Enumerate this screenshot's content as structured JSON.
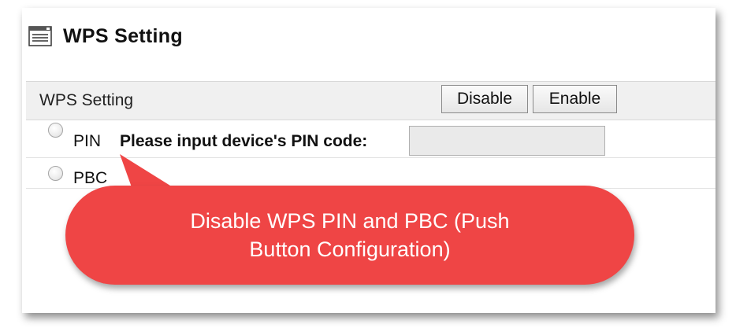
{
  "header": {
    "icon": "settings-page-icon",
    "title": "WPS Setting"
  },
  "wps": {
    "section_label": "WPS Setting",
    "disable_label": "Disable",
    "enable_label": "Enable"
  },
  "options": {
    "pin_label": "PIN",
    "pin_prompt": "Please input device's PIN code:",
    "pin_value": "",
    "pbc_label": "PBC"
  },
  "callout": {
    "text": "Disable WPS PIN and PBC (Push Button Configuration)",
    "color": "#ef4545"
  },
  "colors": {
    "section_background": "#f0f0f0",
    "input_background": "#eaeaea",
    "callout_text": "#ffffff"
  }
}
